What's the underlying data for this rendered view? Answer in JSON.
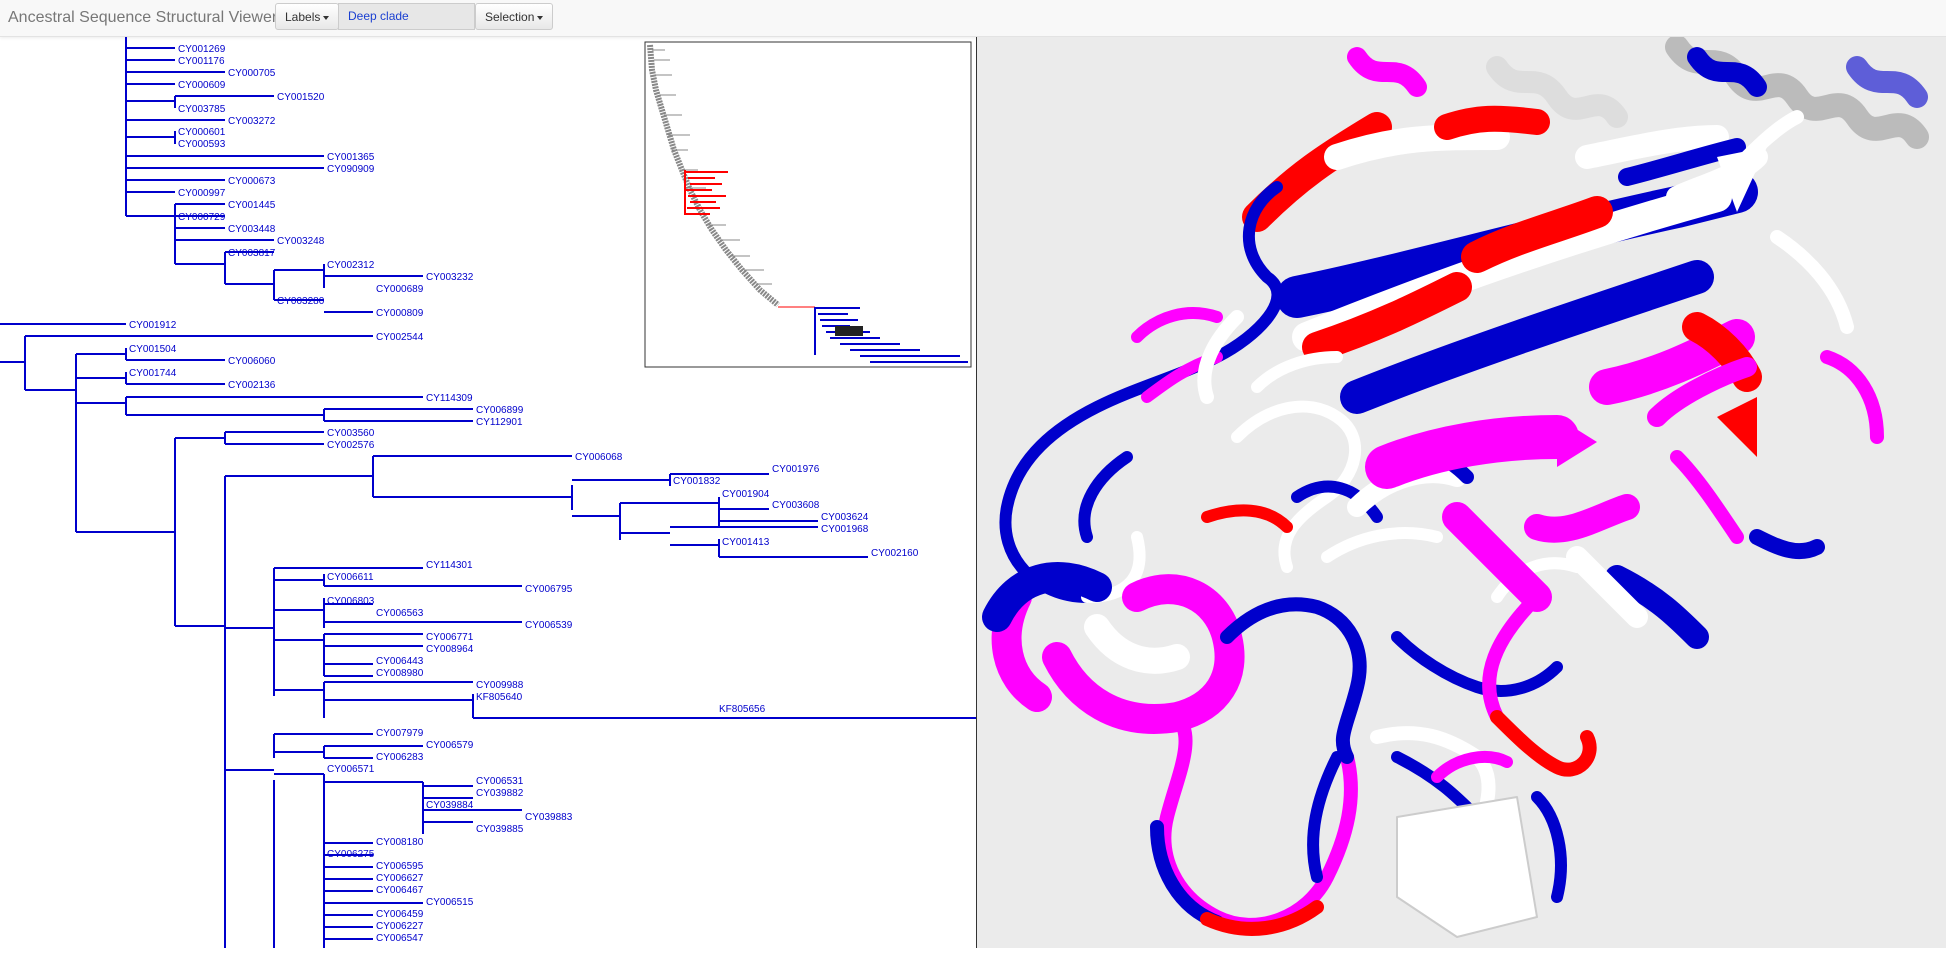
{
  "app": {
    "title": "Ancestral Sequence Structural Viewer"
  },
  "toolbar": {
    "labels_button": "Labels",
    "search_value": "Deep clade",
    "selection_button": "Selection"
  },
  "colors": {
    "tree": "#0000cc",
    "highlight": "#ff0000",
    "overview_grey": "#888888",
    "magenta": "#ff00ff"
  },
  "tree": {
    "leaves": [
      "CY001269",
      "CY001176",
      "CY000705",
      "CY000609",
      "CY001520",
      "CY003785",
      "CY003272",
      "CY000601",
      "CY000593",
      "CY001365",
      "CY090909",
      "CY000673",
      "CY000997",
      "CY001445",
      "CY000729",
      "CY003448",
      "CY003248",
      "CY003817",
      "CY002312",
      "CY003232",
      "CY000689",
      "CY003280",
      "CY000809",
      "CY001912",
      "CY002544",
      "CY001504",
      "CY006060",
      "CY001744",
      "CY002136",
      "CY114309",
      "CY006899",
      "CY112901",
      "CY003560",
      "CY002576",
      "CY006068",
      "CY001832",
      "CY001976",
      "CY001904",
      "CY003608",
      "CY003624",
      "CY001968",
      "CY001413",
      "CY002160",
      "CY114301",
      "CY006611",
      "CY006795",
      "CY006803",
      "CY006563",
      "CY006539",
      "CY006771",
      "CY008964",
      "CY006443",
      "CY008980",
      "CY009988",
      "KF805640",
      "KF805656",
      "CY007979",
      "CY006579",
      "CY006283",
      "CY006571",
      "CY006531",
      "CY039882",
      "CY039884",
      "CY039883",
      "CY039885",
      "CY008180",
      "CY006275",
      "CY006595",
      "CY006627",
      "CY006467",
      "CY006515",
      "CY006459",
      "CY006227",
      "CY006547"
    ]
  }
}
